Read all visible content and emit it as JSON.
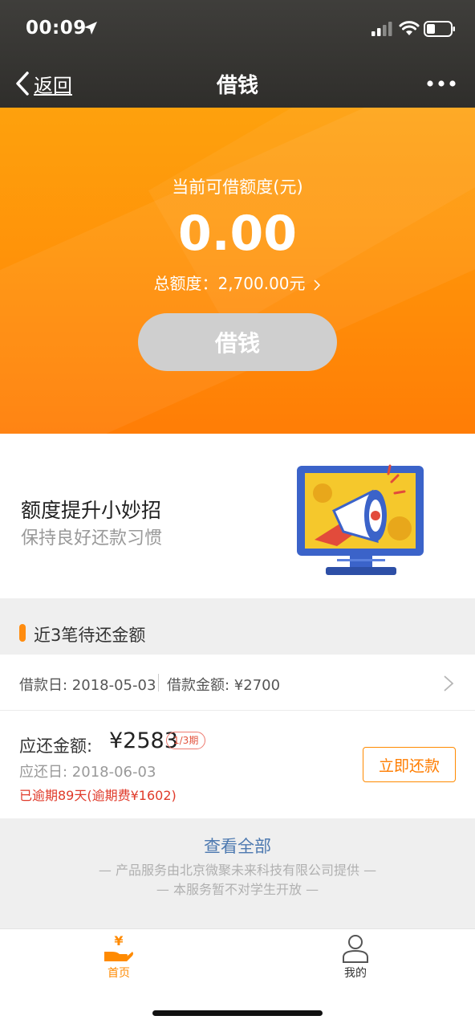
{
  "status_bar": {
    "time": "00:09"
  },
  "nav": {
    "back_label": "返回",
    "title": "借钱"
  },
  "hero": {
    "available_label": "当前可借额度(元)",
    "available_amount": "0.00",
    "total_quota": "总额度：2,700.00元",
    "borrow_button": "借钱"
  },
  "promo": {
    "title": "额度提升小妙招",
    "subtitle": "保持良好还款习惯"
  },
  "section": {
    "title": "近3笔待还金额"
  },
  "loan": {
    "loan_date": "借款日: 2018-05-03",
    "loan_amount": "借款金额: ¥2700",
    "due_label": "应还金额:",
    "due_amount": "¥2583",
    "period": "1/3期",
    "due_date": "应还日: 2018-06-03",
    "overdue": "已逾期89天(逾期费¥1602)",
    "repay_button": "立即还款"
  },
  "footer": {
    "view_all": "查看全部",
    "provider": "— 产品服务由北京微聚未来科技有限公司提供 —",
    "notice": "— 本服务暂不对学生开放 —"
  },
  "tabbar": {
    "home": "首页",
    "mine": "我的"
  },
  "colors": {
    "accent": "#ff8a00",
    "overdue": "#e03a2a",
    "link": "#4d79b0"
  },
  "icons": [
    "location-arrow-icon",
    "signal-icon",
    "wifi-icon",
    "battery-icon",
    "back-chevron-icon",
    "more-dots-icon",
    "chevron-right-icon",
    "megaphone-monitor-illustration",
    "yen-hand-icon",
    "user-icon"
  ]
}
